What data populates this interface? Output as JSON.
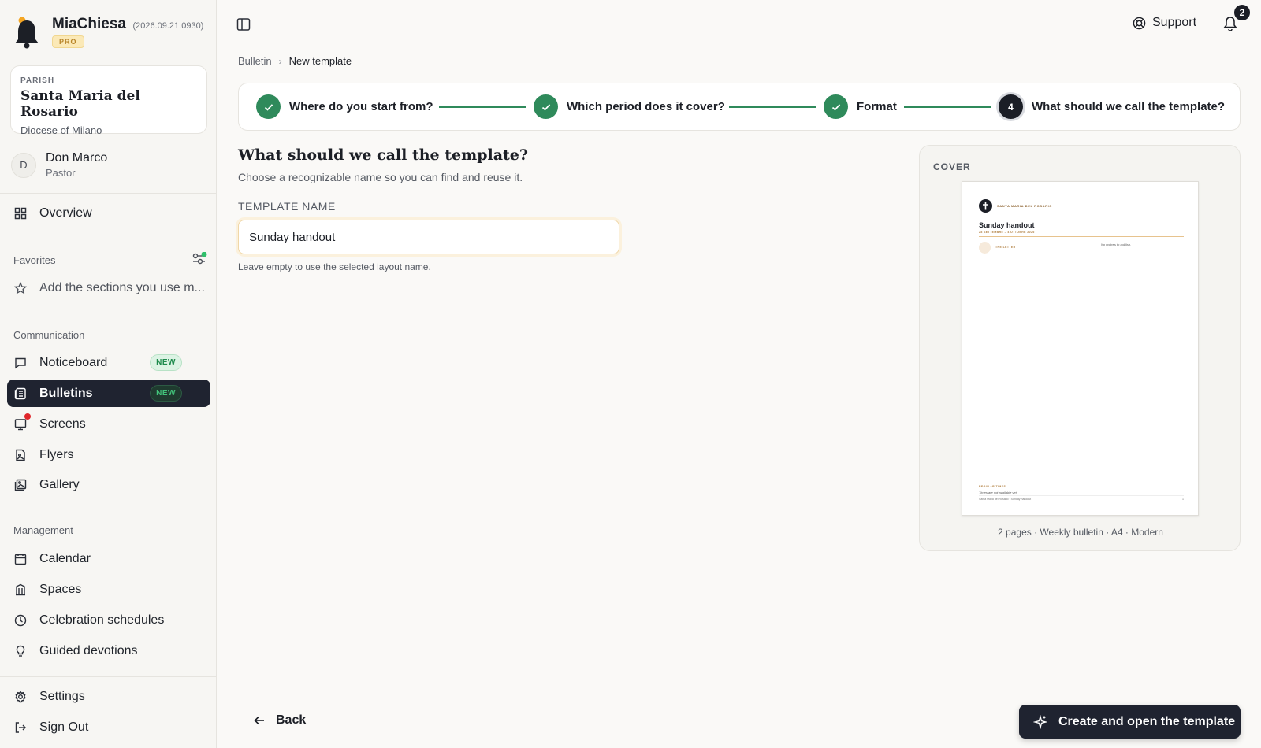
{
  "app": {
    "name": "MiaChiesa",
    "version": "(2026.09.21.0930)",
    "plan_badge": "PRO"
  },
  "parish": {
    "label": "PARISH",
    "name": "Santa Maria del Rosario",
    "diocese": "Diocese of Milano"
  },
  "user": {
    "initial": "D",
    "name": "Don Marco",
    "role": "Pastor"
  },
  "nav": {
    "overview": "Overview",
    "favorites_title": "Favorites",
    "favorites_hint": "Add the sections you use m...",
    "communication_title": "Communication",
    "noticeboard": "Noticeboard",
    "bulletins": "Bulletins",
    "new_badge": "NEW",
    "screens": "Screens",
    "flyers": "Flyers",
    "gallery": "Gallery",
    "management_title": "Management",
    "calendar": "Calendar",
    "spaces": "Spaces",
    "celebration_schedules": "Celebration schedules",
    "guided_devotions": "Guided devotions",
    "settings": "Settings",
    "sign_out": "Sign Out"
  },
  "topbar": {
    "support": "Support",
    "notification_count": "2"
  },
  "breadcrumb": {
    "parent": "Bulletin",
    "current": "New template"
  },
  "stepper": {
    "steps": [
      {
        "label": "Where do you start from?",
        "status": "done"
      },
      {
        "label": "Which period does it cover?",
        "status": "done"
      },
      {
        "label": "Format",
        "status": "done"
      },
      {
        "label": "What should we call the template?",
        "status": "current",
        "number": "4"
      }
    ]
  },
  "form": {
    "title": "What should we call the template?",
    "subtitle": "Choose a recognizable name so you can find and reuse it.",
    "field_label": "TEMPLATE NAME",
    "field_value": "Sunday handout",
    "field_help": "Leave empty to use the selected layout name."
  },
  "preview": {
    "label": "COVER",
    "page": {
      "parish": "SANTA MARIA DEL ROSARIO",
      "title": "Sunday handout",
      "dates": "28 SETTEMBRE – 4 OTTOBRE 2026",
      "letter": "THE LETTER",
      "notices": "No notices to publish.",
      "regular": "REGULAR TIMES",
      "times": "Times are not available yet.",
      "footer": "Santa Maria del Rosario · Sunday handout",
      "page_number": "1"
    },
    "caption": "2 pages · Weekly bulletin · A4 · Modern"
  },
  "actions": {
    "back": "Back",
    "create": "Create and open the template"
  },
  "colors": {
    "accent_dark": "#1f2330",
    "step_done": "#2f8a5b",
    "pro_badge": "#fbe9b7",
    "new_badge": "#dcf3e4",
    "notification_dot": "#e0262b"
  },
  "icons": {
    "brand": "bell-logo-icon",
    "sidebar_toggle": "sidebar-toggle-icon",
    "support": "lifebuoy-icon",
    "notifications": "bell-icon",
    "back": "arrow-left-icon",
    "create": "sparkles-icon"
  }
}
